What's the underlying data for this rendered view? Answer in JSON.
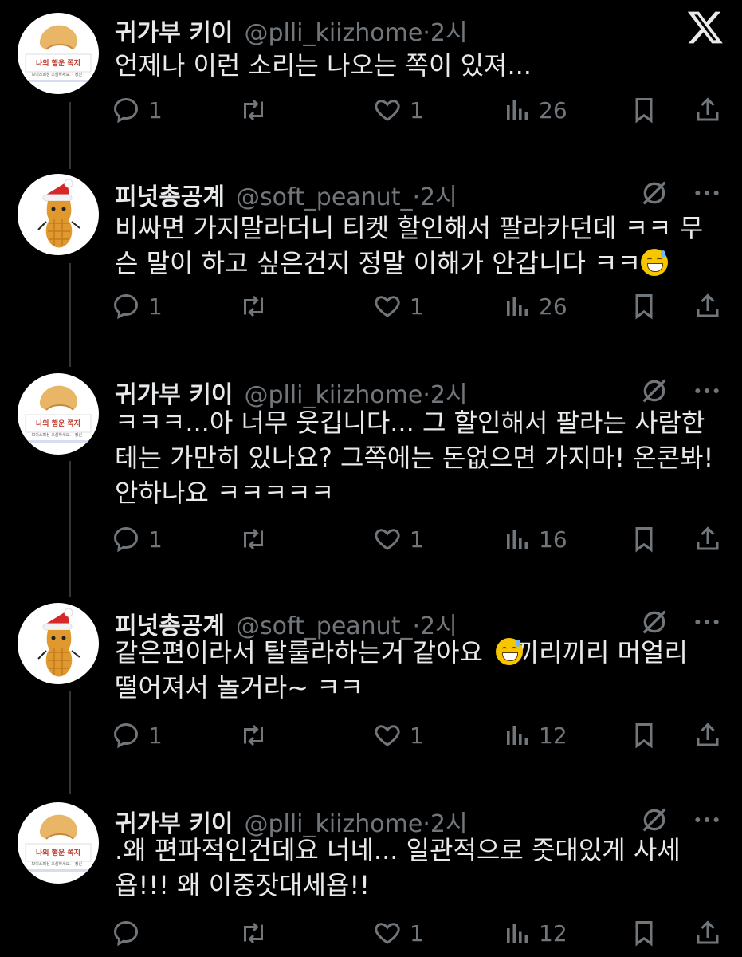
{
  "tweets": [
    {
      "name": "귀가부 키이",
      "handle": "@plli_kiizhome",
      "time": "·2시",
      "text": "언제나 이런 소리는 나오는 쪽이 있져...",
      "replies": "1",
      "retweets": "",
      "likes": "1",
      "views": "26",
      "avatar": "fortune-cookie",
      "avatar_text": "나의 행운 쪽지",
      "avatar_subtext": "보이스피싱 조심하세요. - 정신 -"
    },
    {
      "name": "피넛총공계",
      "handle": "@soft_peanut_",
      "time": "·2시",
      "text": "비싸면 가지말라더니 티켓 할인해서 팔라카던데 ㅋㅋ 무\n슨 말이 하고 싶은건지 정말 이해가 안갑니다 ㅋㅋ",
      "replies": "1",
      "retweets": "",
      "likes": "1",
      "views": "26",
      "avatar": "peanut-santa"
    },
    {
      "name": "귀가부 키이",
      "handle": "@plli_kiizhome",
      "time": "·2시",
      "text": "ㅋㅋㅋ...아 너무 웃깁니다... 그 할인해서 팔라는 사람한\n테는 가만히 있나요? 그쪽에는 돈없으면 가지마! 온콘봐!\n안하나요 ㅋㅋㅋㅋㅋ",
      "replies": "1",
      "retweets": "",
      "likes": "1",
      "views": "16",
      "avatar": "fortune-cookie",
      "avatar_text": "나의 행운 쪽지",
      "avatar_subtext": "보이스피싱 조심하세요. - 정신 -"
    },
    {
      "name": "피넛총공계",
      "handle": "@soft_peanut_",
      "time": "·2시",
      "text": "같은편이라서 탈룰라하는거 같아요    끼리끼리 머얼리\n떨어져서 놀거라~ ㅋㅋ",
      "replies": "1",
      "retweets": "",
      "likes": "1",
      "views": "12",
      "avatar": "peanut-santa"
    },
    {
      "name": "귀가부 키이",
      "handle": "@plli_kiizhome",
      "time": "·2시",
      "text": ".왜 편파적인건데요 너네... 일관적으로 줏대있게 사세\n욥!!! 왜 이중잣대세욥!!",
      "replies": "",
      "retweets": "",
      "likes": "1",
      "views": "12",
      "avatar": "fortune-cookie",
      "avatar_text": "나의 행운 쪽지",
      "avatar_subtext": "보이스피싱 조심하세요. - 정신 -"
    }
  ],
  "colors": {
    "background": "#000000",
    "text": "#e7e9ea",
    "muted": "#71767b",
    "thread_line": "#333639"
  }
}
